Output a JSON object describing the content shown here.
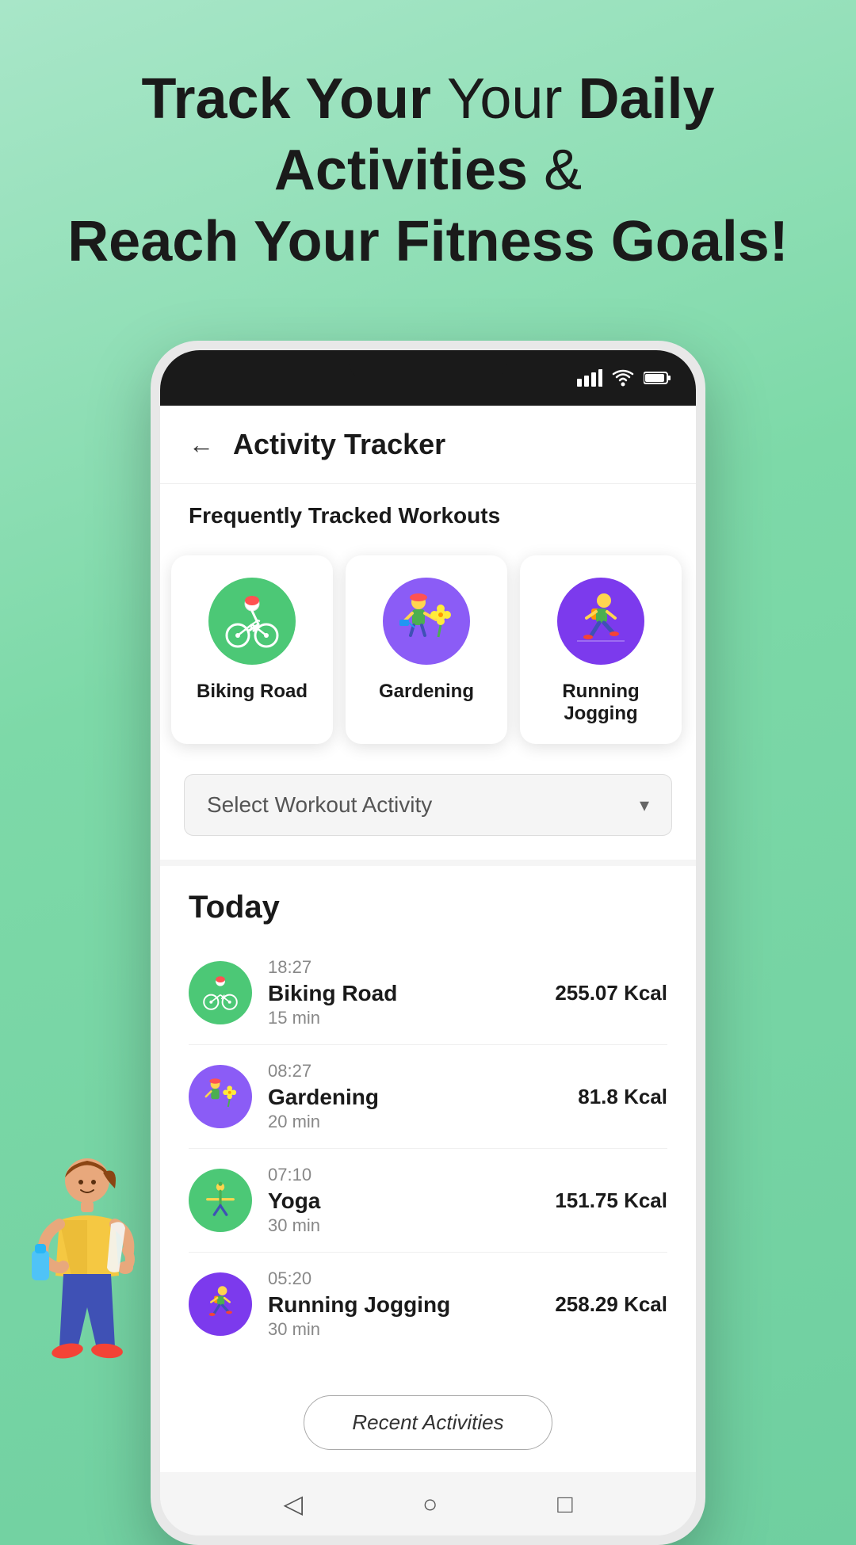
{
  "hero": {
    "line1_plain": "Track Your ",
    "line1_bold": "Daily Activities",
    "line1_end": " &",
    "line2_bold": "Reach Your Fitness Goals!"
  },
  "app": {
    "title": "Activity Tracker",
    "back_label": "←"
  },
  "frequently_tracked": {
    "section_label": "Frequently Tracked Workouts",
    "activities": [
      {
        "name": "Biking Road",
        "color": "green"
      },
      {
        "name": "Gardening",
        "color": "purple"
      },
      {
        "name": "Running Jogging",
        "color": "purple2"
      }
    ]
  },
  "dropdown": {
    "placeholder": "Select Workout Activity"
  },
  "today": {
    "title": "Today",
    "items": [
      {
        "time": "18:27",
        "name": "Biking Road",
        "duration": "15 min",
        "calories": "255.07 Kcal",
        "color": "green"
      },
      {
        "time": "08:27",
        "name": "Gardening",
        "duration": "20 min",
        "calories": "81.8 Kcal",
        "color": "purple"
      },
      {
        "time": "07:10",
        "name": "Yoga",
        "duration": "30 min",
        "calories": "151.75 Kcal",
        "color": "green2"
      },
      {
        "time": "05:20",
        "name": "Running Jogging",
        "duration": "30 min",
        "calories": "258.29 Kcal",
        "color": "purple2"
      }
    ]
  },
  "recent_btn": "Recent Activities",
  "nav": {
    "back_icon": "◁",
    "home_icon": "○",
    "square_icon": "□"
  },
  "status": {
    "signal": "▋▋▋▋",
    "wifi": "WiFi",
    "battery": "🔋"
  }
}
